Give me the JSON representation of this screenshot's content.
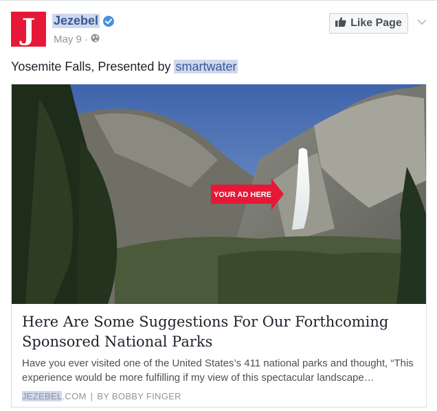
{
  "page": {
    "name": "Jezebel",
    "date": "May 9",
    "dot": "·",
    "logo_letter": "J"
  },
  "actions": {
    "like_page": "Like Page"
  },
  "post": {
    "text_prefix": "Yosemite Falls, Presented by ",
    "text_link": "smartwater"
  },
  "attachment": {
    "ad_label": "YOUR AD HERE",
    "headline": "Here Are Some Suggestions For Our Forthcoming Sponsored National Parks",
    "description": "Have you ever visited one of the United States’s 411 national parks and thought, “This experience would be more fulfilling if my view of this spectacular landscape…",
    "source_domain_hl": "JEZEBEL",
    "source_domain_rest": ".COM",
    "source_sep": "|",
    "source_author": "BY BOBBY FINGER"
  },
  "colors": {
    "brand": "#e51937",
    "link": "#365899",
    "highlight": "#cfd8ec",
    "verified": "#4a90e2"
  },
  "icons": {
    "verified": "verified-badge-icon",
    "privacy": "globe-icon",
    "like": "thumbs-up-icon",
    "menu": "chevron-down-icon"
  }
}
